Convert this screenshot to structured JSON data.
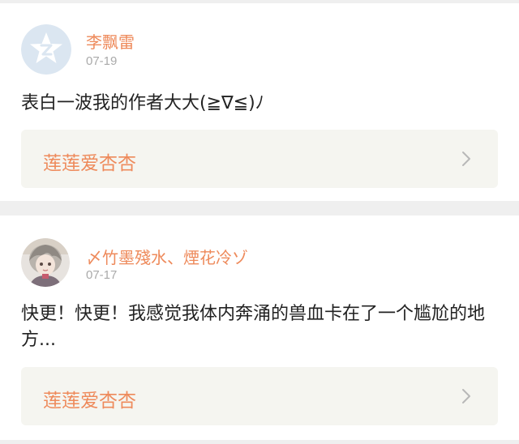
{
  "posts": [
    {
      "username": "李飘雷",
      "date": "07-19",
      "content": "表白一波我的作者大大(≧∇≦)ﾉ",
      "link_label": "莲莲爱杏杏",
      "avatar_icon": "default-qq-avatar-icon"
    },
    {
      "username": "〆竹墨殘水、煙花冷ゾ",
      "date": "07-17",
      "content": "快更！快更！我感觉我体内奔涌的兽血卡在了一个尴尬的地方...",
      "link_label": "莲莲爱杏杏",
      "avatar_icon": "anime-character-avatar-icon"
    }
  ],
  "colors": {
    "accent": "#ee8a5b",
    "date": "#aaaaaa",
    "text": "#222222",
    "link_bg": "#f5f5f0",
    "page_bg": "#efefef",
    "chevron": "#b8b8b8"
  }
}
